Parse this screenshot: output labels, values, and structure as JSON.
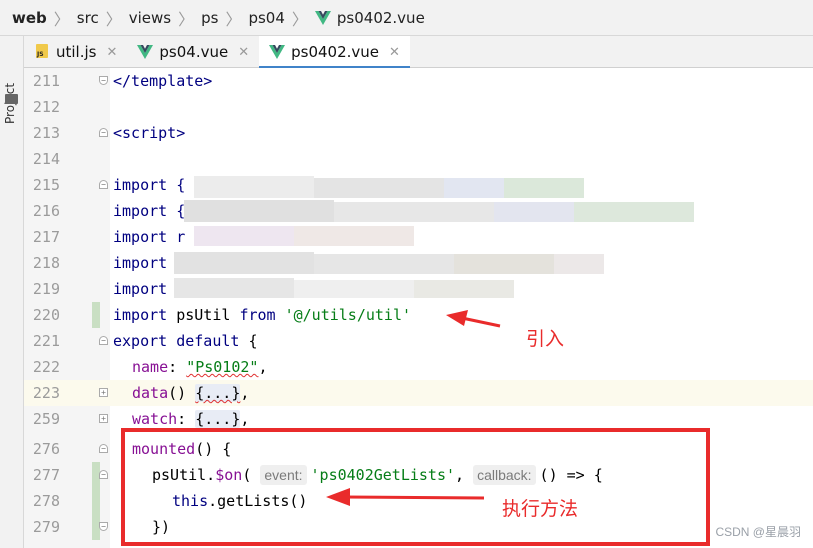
{
  "breadcrumb": [
    "web",
    "src",
    "views",
    "ps",
    "ps04",
    "ps0402.vue"
  ],
  "side_panel": {
    "label": "Project"
  },
  "tabs": [
    {
      "label": "util.js",
      "icon": "js-file-icon",
      "active": false
    },
    {
      "label": "ps04.vue",
      "icon": "vue-file-icon",
      "active": false
    },
    {
      "label": "ps0402.vue",
      "icon": "vue-file-icon",
      "active": true
    }
  ],
  "editor": {
    "lines": [
      {
        "num": "211",
        "code": "</template>"
      },
      {
        "num": "212",
        "code": ""
      },
      {
        "num": "213",
        "code": "<script>"
      },
      {
        "num": "214",
        "code": ""
      },
      {
        "num": "215",
        "code": "import {"
      },
      {
        "num": "216",
        "code": "import {"
      },
      {
        "num": "217",
        "code": "import r"
      },
      {
        "num": "218",
        "code": "import"
      },
      {
        "num": "219",
        "code": "import"
      },
      {
        "num": "220",
        "kw": "import",
        "name": " psUtil ",
        "from": "from",
        "path": "'@/utils/util'"
      },
      {
        "num": "221",
        "kw1": "export",
        "kw2": " default",
        "rest": " {"
      },
      {
        "num": "222",
        "prop": "name",
        "colon": ": ",
        "val": "\"Ps0102\"",
        "end": ","
      },
      {
        "num": "223",
        "prop": "data",
        "mid": "() ",
        "folded": "{...}",
        "end": ","
      },
      {
        "num": "259",
        "prop": "watch",
        "colon": ": ",
        "folded": "{...}",
        "end": ","
      },
      {
        "num": "276",
        "prop": "mounted",
        "rest": "() {"
      },
      {
        "num": "277",
        "pre": "psUtil.",
        "method": "$on",
        "open": "(",
        "hint1": "event:",
        "arg1": "'ps0402GetLists'",
        "comma": ", ",
        "hint2": "callback:",
        "rest": "() => {"
      },
      {
        "num": "278",
        "kw": "this",
        "rest": ".getLists()"
      },
      {
        "num": "279",
        "rest": "})"
      }
    ]
  },
  "annotations": {
    "import_label": "引入",
    "method_label": "执行方法"
  },
  "watermark": "CSDN @星晨羽",
  "colors": {
    "keyword": "#000080",
    "string": "#067d17",
    "property": "#871094",
    "annotation": "#e92b2b",
    "accent": "#4083c9"
  }
}
